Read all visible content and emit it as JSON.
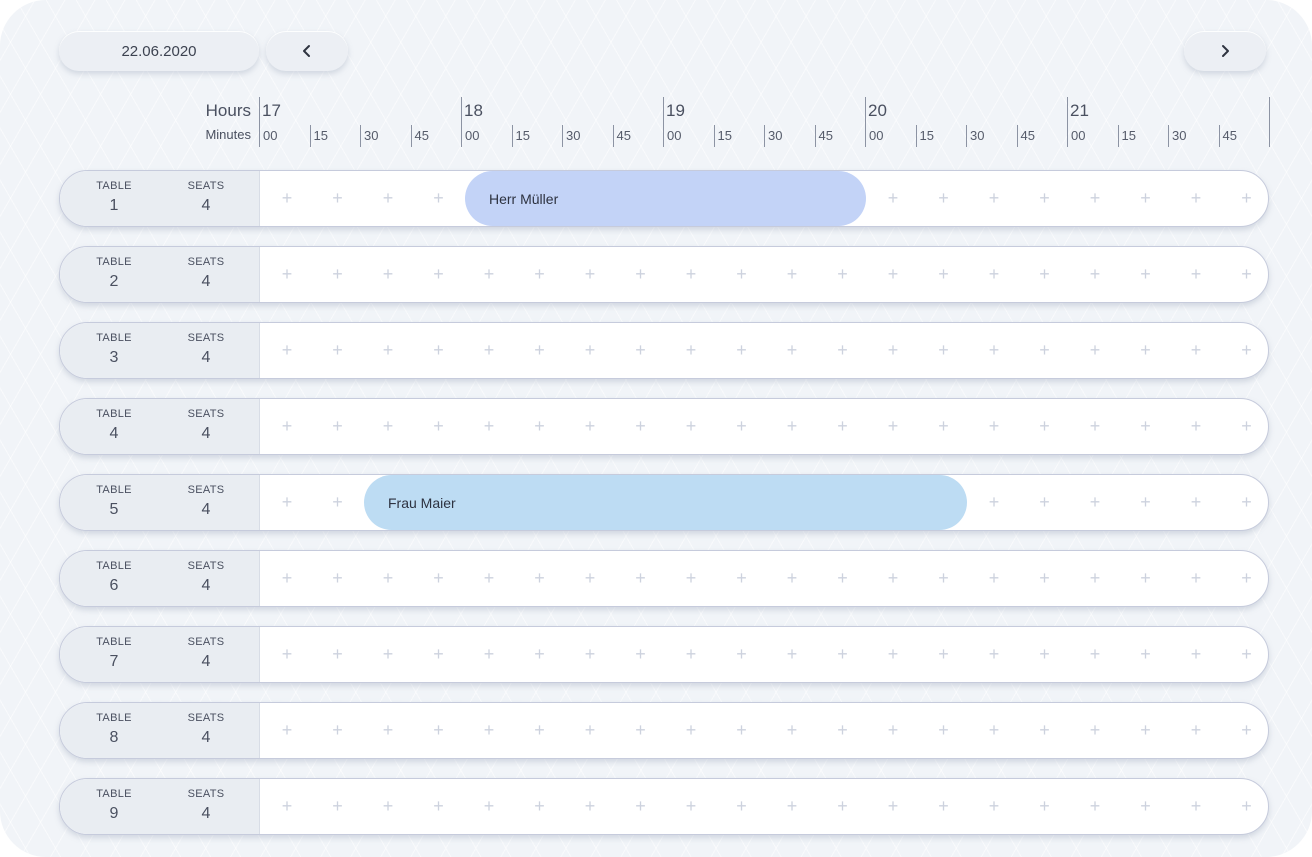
{
  "toolbar": {
    "date": "22.06.2020",
    "prev_icon": "chevron-left-icon",
    "next_icon": "chevron-right-icon"
  },
  "timeline": {
    "hours_label": "Hours",
    "minutes_label": "Minutes",
    "hours": [
      "17",
      "18",
      "19",
      "20",
      "21"
    ],
    "minutes": [
      "00",
      "15",
      "30",
      "45"
    ]
  },
  "table_caption": "TABLE",
  "seats_caption": "SEATS",
  "add_slot_symbol": "+",
  "tables": [
    {
      "table": "1",
      "seats": "4"
    },
    {
      "table": "2",
      "seats": "4"
    },
    {
      "table": "3",
      "seats": "4"
    },
    {
      "table": "4",
      "seats": "4"
    },
    {
      "table": "5",
      "seats": "4"
    },
    {
      "table": "6",
      "seats": "4"
    },
    {
      "table": "7",
      "seats": "4"
    },
    {
      "table": "8",
      "seats": "4"
    },
    {
      "table": "9",
      "seats": "4"
    }
  ],
  "bookings": [
    {
      "table": "1",
      "name": "Herr Müller",
      "start": "18:00",
      "end": "20:00",
      "color": "#c3d3f7"
    },
    {
      "table": "5",
      "name": "Frau Maier",
      "start": "17:30",
      "end": "20:30",
      "color": "#bddcf3"
    }
  ]
}
